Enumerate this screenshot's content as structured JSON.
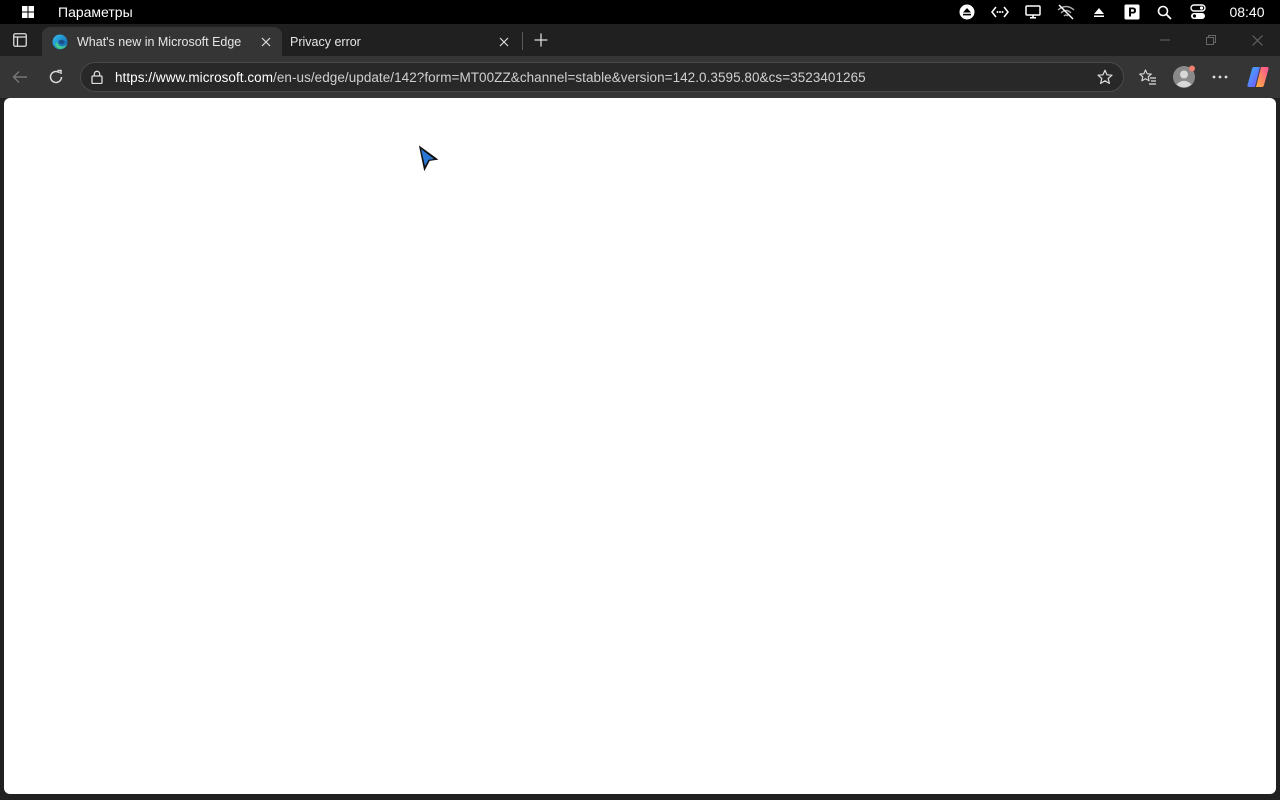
{
  "system_bar": {
    "app_title": "Параметры",
    "clock": "08:40",
    "tray_icons": [
      "eject-icon",
      "code-brackets-icon",
      "monitor-icon",
      "wifi-off-icon",
      "caret-up-icon",
      "p-badge-icon",
      "search-icon",
      "toggle-icon"
    ]
  },
  "tabs": [
    {
      "title": "What's new in Microsoft Edge",
      "icon": "edge-logo-icon",
      "active": true
    },
    {
      "title": "Privacy error",
      "active": false
    }
  ],
  "toolbar": {
    "url_host": "https://www.microsoft.com",
    "url_path": "/en-us/edge/update/142?form=MT00ZZ&channel=stable&version=142.0.3595.80&cs=3523401265"
  },
  "colors": {
    "chrome_bg": "#202020",
    "toolbar_bg": "#353535",
    "page_bg": "#ffffff"
  }
}
